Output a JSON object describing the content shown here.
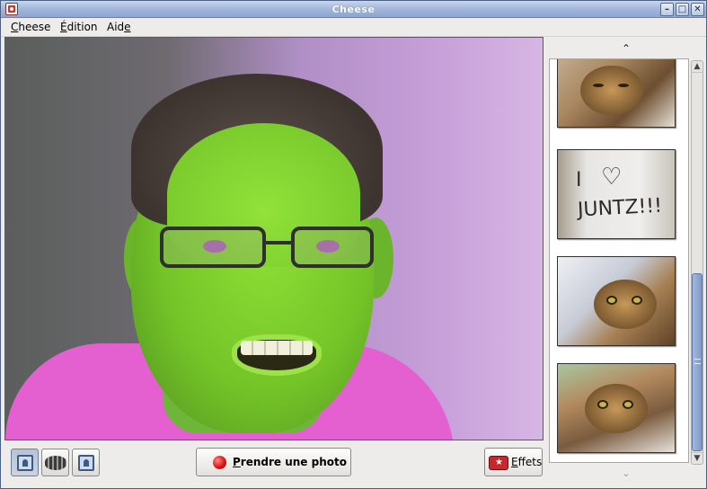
{
  "window": {
    "title": "Cheese"
  },
  "menubar": {
    "items": [
      {
        "label": "Cheese",
        "mnemonic": "C",
        "rest": "heese"
      },
      {
        "label": "Édition",
        "mnemonic": "É",
        "rest": "dition"
      },
      {
        "label": "Aide",
        "pre": "Aid",
        "mnemonic": "e"
      }
    ]
  },
  "sidebar": {
    "scroll_up_glyph": "⌃",
    "scroll_down_glyph": "⌄",
    "thumbnails": [
      {
        "subject": "cat sleeping"
      },
      {
        "subject": "sign",
        "text_line1": "I",
        "text_line2": "JUNTZ!!!"
      },
      {
        "subject": "cat looking up"
      },
      {
        "subject": "cat close-up"
      }
    ]
  },
  "toolbar": {
    "modes": [
      {
        "name": "photo",
        "icon": "photo-mode-icon",
        "active": true
      },
      {
        "name": "video",
        "icon": "video-mode-icon",
        "active": false
      },
      {
        "name": "burst",
        "icon": "burst-mode-icon",
        "active": false
      }
    ],
    "take_photo": {
      "mnemonic": "P",
      "rest": "rendre une photo",
      "icon": "record-icon"
    },
    "effects": {
      "mnemonic": "E",
      "rest": "ffets",
      "icon": "effects-icon"
    }
  },
  "colors": {
    "titlebar": "#9fb4d9",
    "window_bg": "#edeceb",
    "record_red": "#e01515",
    "scroll_thumb": "#7f98c6"
  }
}
